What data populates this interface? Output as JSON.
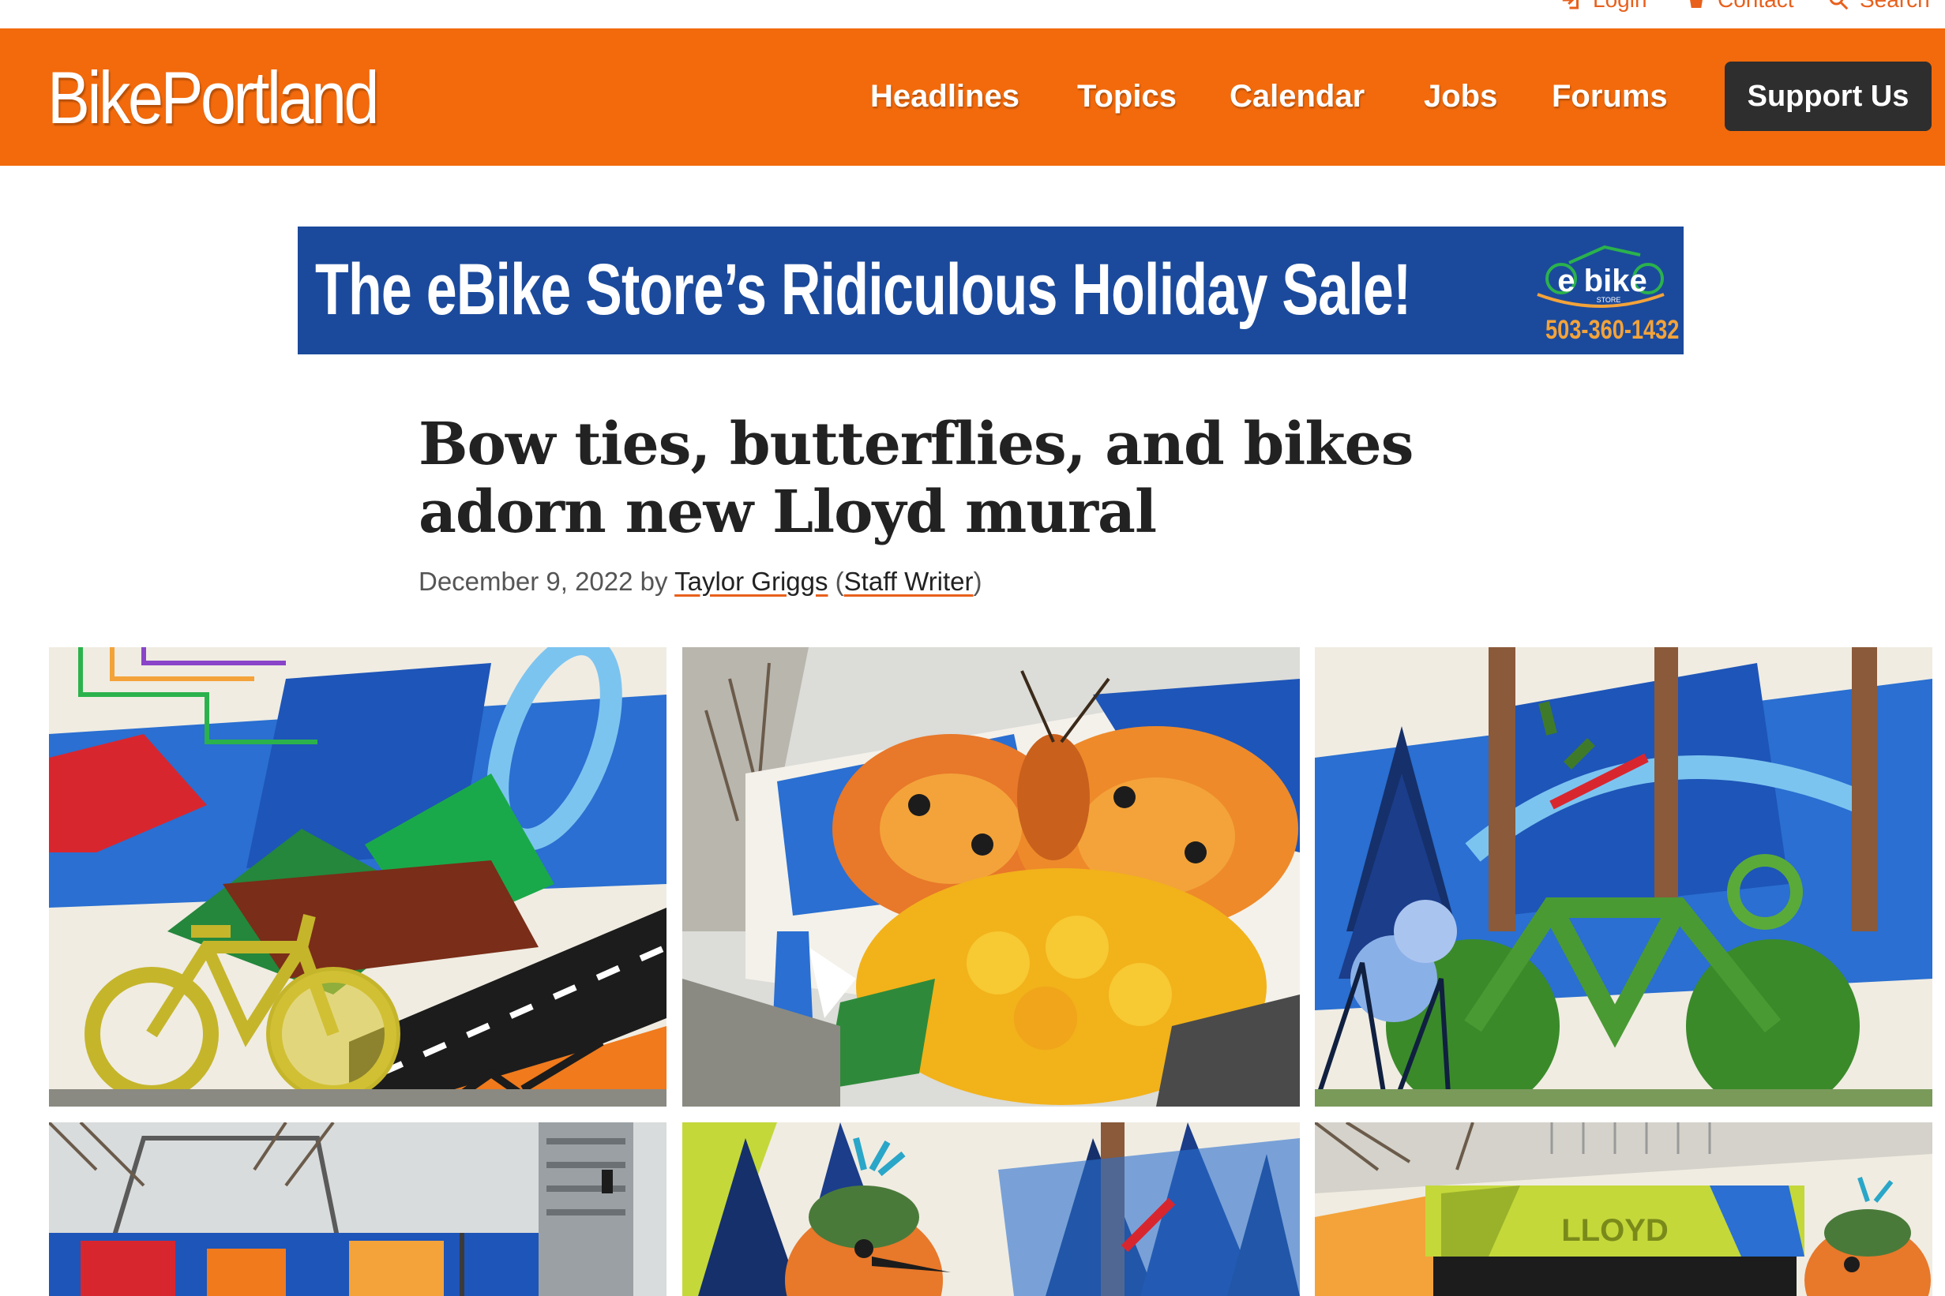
{
  "utility": {
    "login_label": "Login",
    "contact_label": "Contact",
    "search_label": "Search"
  },
  "header": {
    "logo_text": "BikePortland",
    "nav": [
      "Headlines",
      "Topics",
      "Calendar",
      "Jobs",
      "Forums"
    ],
    "support_label": "Support Us"
  },
  "ad": {
    "headline": "The eBike Store’s Ridiculous Holiday Sale!",
    "logo_text": "e bike",
    "logo_sub": "STORE",
    "phone": "503-360-1432"
  },
  "article": {
    "title": "Bow ties, butterflies, and bikes adorn new Lloyd mural",
    "date": "December 9, 2022",
    "by": "by",
    "author": "Taylor Griggs",
    "role": "Staff Writer"
  },
  "gallery": {
    "lloyd_sign": "LLOYD"
  },
  "colors": {
    "brand_orange": "#f26a0c",
    "support_button": "#2e2e2e",
    "ad_blue": "#1b4a9c",
    "ad_phone_orange": "#f3a33a"
  }
}
